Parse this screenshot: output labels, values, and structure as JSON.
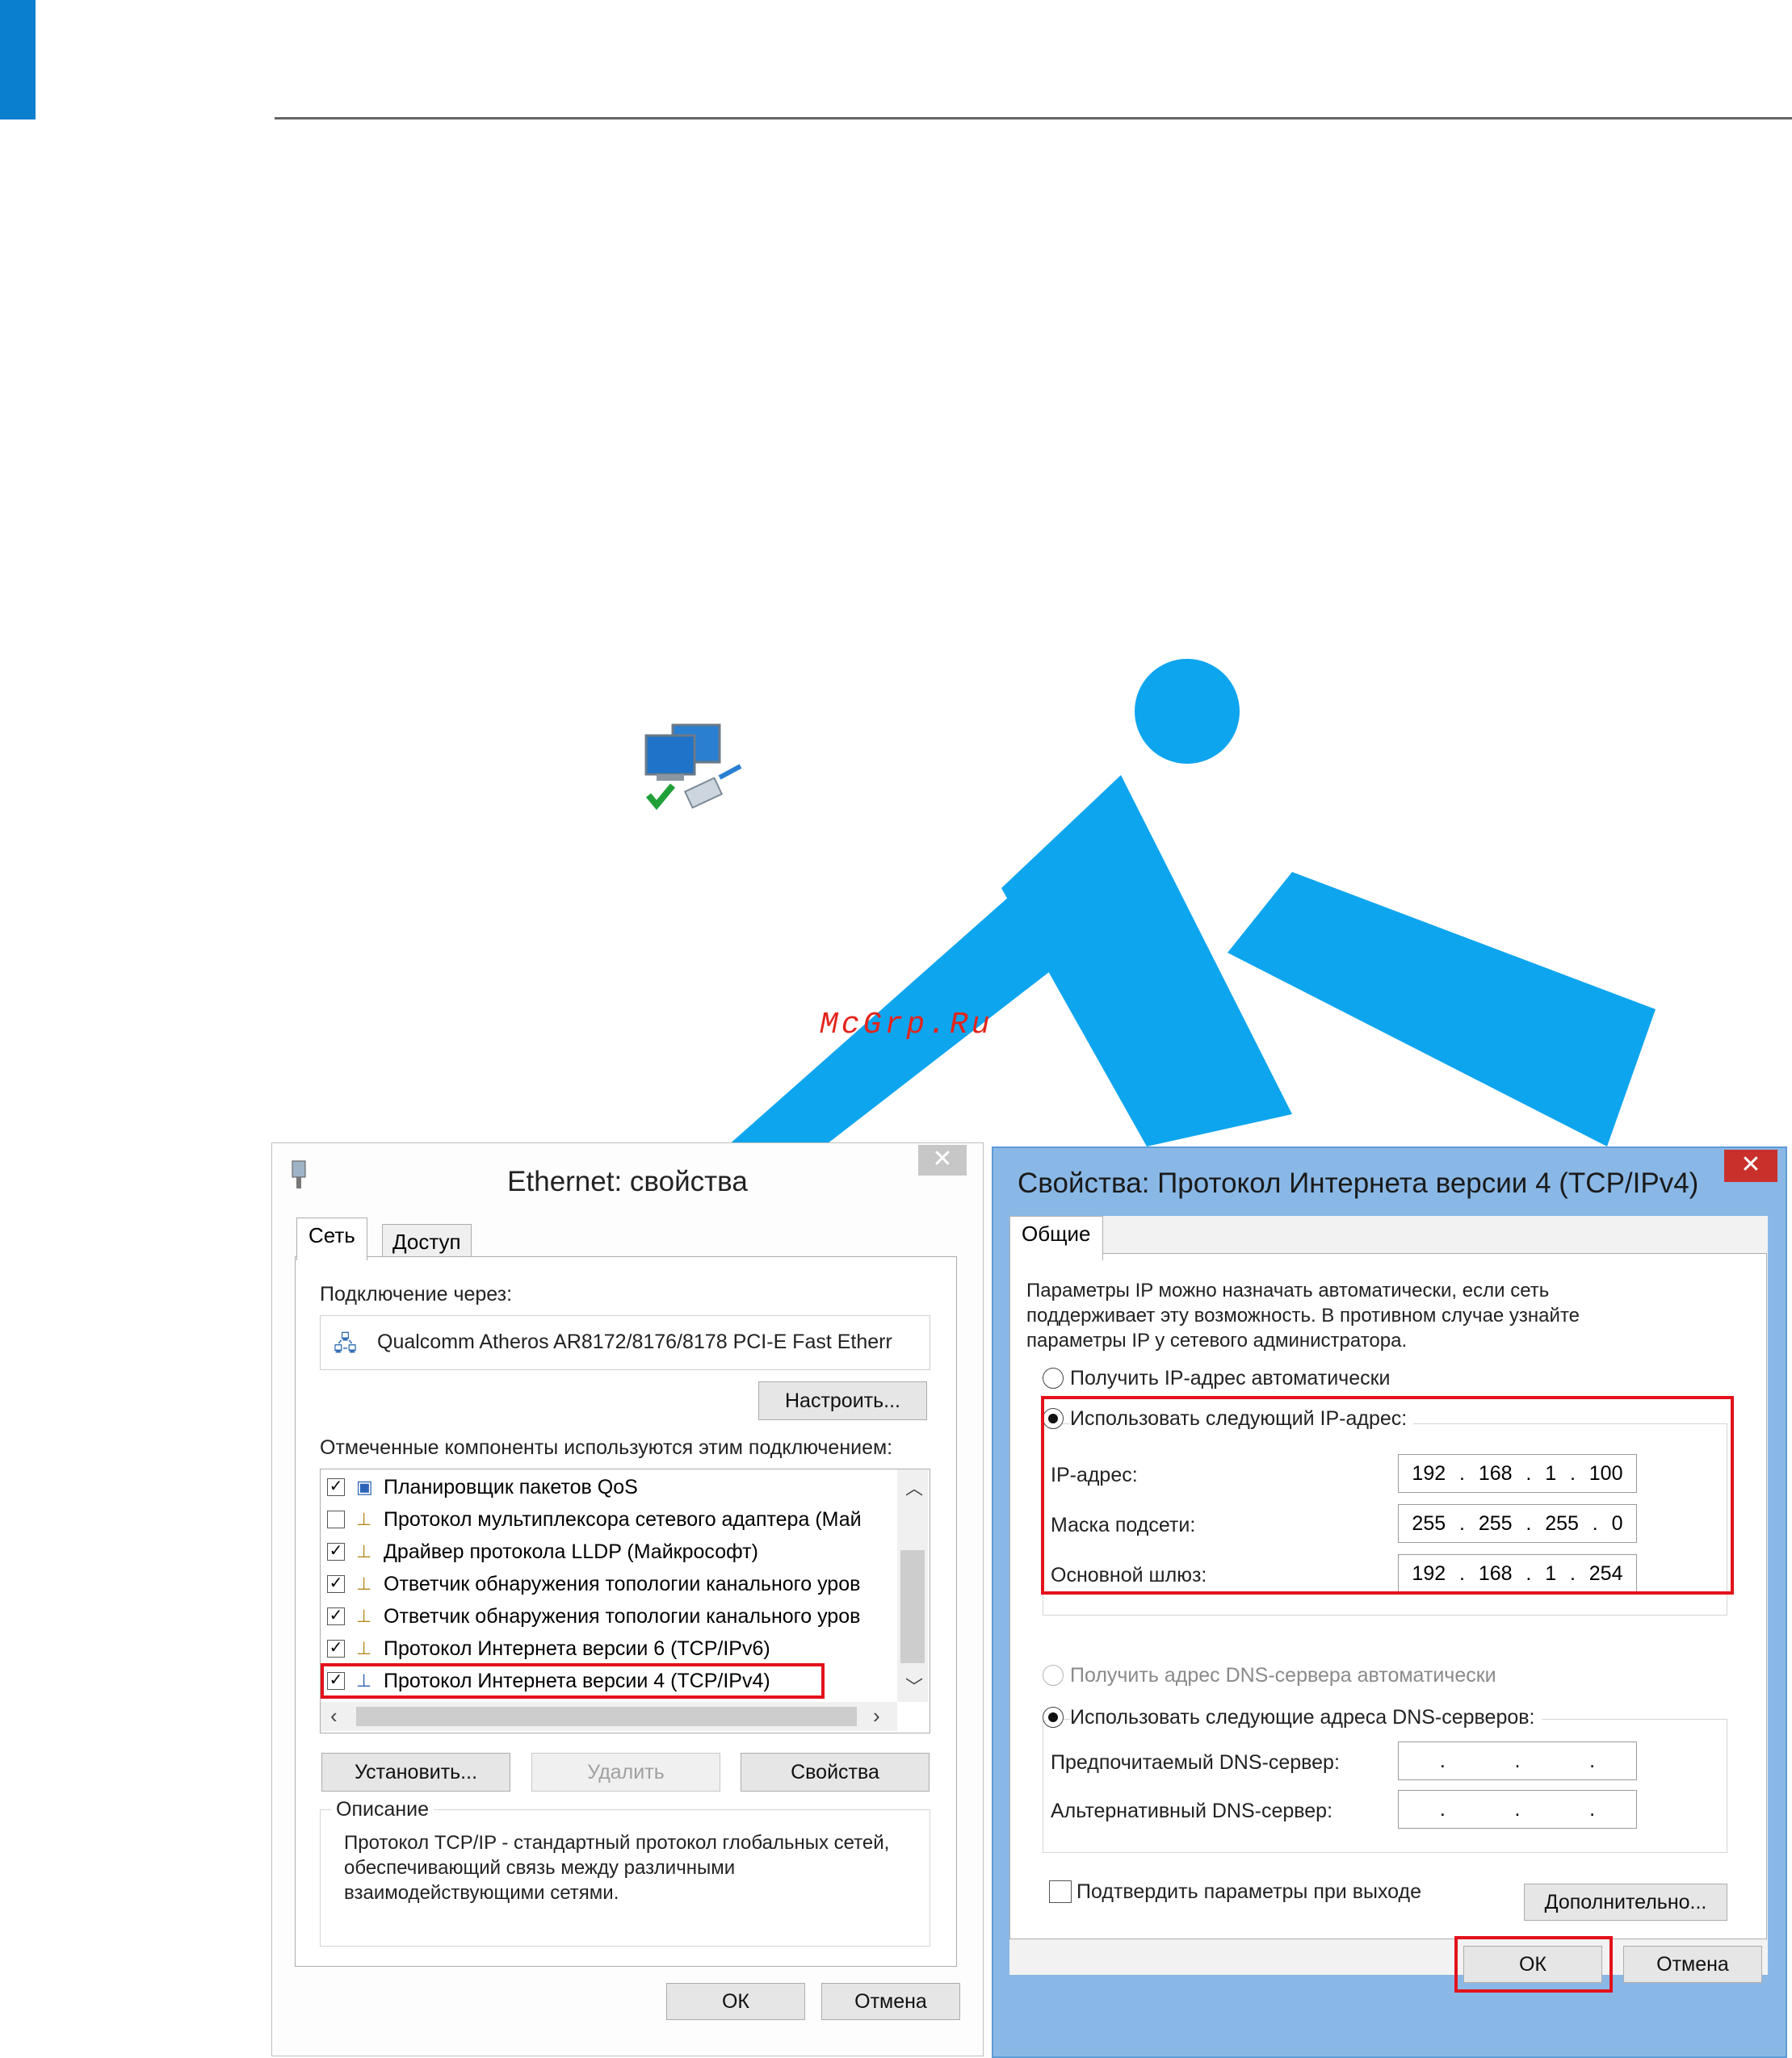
{
  "watermark": "McGrp.Ru",
  "ethernet": {
    "title": "Ethernet: свойства",
    "close": "✕",
    "tabs": [
      "Сеть",
      "Доступ"
    ],
    "connect_via_label": "Подключение через:",
    "adapter_name": "Qualcomm Atheros AR8172/8176/8178 PCI-E Fast Etherr",
    "configure_button": "Настроить...",
    "components_label": "Отмеченные компоненты используются этим подключением:",
    "components": [
      {
        "label": "Планировщик пакетов QoS",
        "checked": true
      },
      {
        "label": "Протокол мультиплексора сетевого адаптера (Май",
        "checked": false
      },
      {
        "label": "Драйвер протокола LLDP (Майкрософт)",
        "checked": true
      },
      {
        "label": "Ответчик обнаружения топологии канального уров",
        "checked": true
      },
      {
        "label": "Ответчик обнаружения топологии канального уров",
        "checked": true
      },
      {
        "label": "Протокол Интернета версии 6 (TCP/IPv6)",
        "checked": true
      },
      {
        "label": "Протокол Интернета версии 4 (TCP/IPv4)",
        "checked": true
      }
    ],
    "install_button": "Установить...",
    "remove_button": "Удалить",
    "properties_button": "Свойства",
    "description_label": "Описание",
    "description_text": "Протокол TCP/IP - стандартный протокол глобальных сетей, обеспечивающий связь между различными взаимодействующими сетями.",
    "ok_button": "ОК",
    "cancel_button": "Отмена"
  },
  "ipv4": {
    "title": "Свойства: Протокол Интернета версии 4 (TCP/IPv4)",
    "close": "✕",
    "tab": "Общие",
    "intro": "Параметры IP можно назначать автоматически, если сеть поддерживает эту возможность. В противном случае узнайте параметры IP у сетевого администратора.",
    "radio_auto_ip": "Получить IP-адрес автоматически",
    "radio_manual_ip": "Использовать следующий IP-адрес:",
    "ip_label": "IP-адрес:",
    "ip_value": [
      "192",
      "168",
      "1",
      "100"
    ],
    "mask_label": "Маска подсети:",
    "mask_value": [
      "255",
      "255",
      "255",
      "0"
    ],
    "gateway_label": "Основной шлюз:",
    "gateway_value": [
      "192",
      "168",
      "1",
      "254"
    ],
    "radio_auto_dns": "Получить адрес DNS-сервера автоматически",
    "radio_manual_dns": "Использовать следующие адреса DNS-серверов:",
    "preferred_dns_label": "Предпочитаемый DNS-сервер:",
    "alternate_dns_label": "Альтернативный DNS-сервер:",
    "validate_checkbox": "Подтвердить параметры при выходе",
    "advanced_button": "Дополнительно...",
    "ok_button": "ОК",
    "cancel_button": "Отмена"
  }
}
